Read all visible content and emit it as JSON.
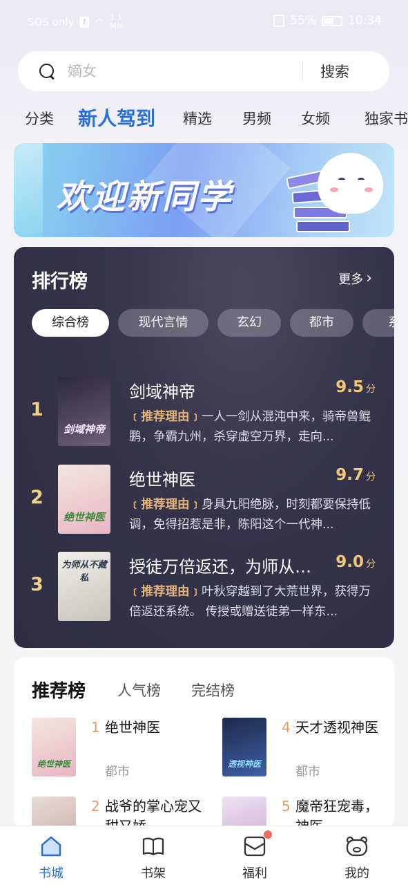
{
  "status_bar": {
    "carrier": "SOS only",
    "speed_value": "1.1",
    "speed_unit": "M/s",
    "battery": "55%",
    "battery_level": 0.55,
    "time": "10:34"
  },
  "search": {
    "placeholder": "嫡女",
    "button": "搜索"
  },
  "tabs": [
    "分类",
    "新人驾到",
    "精选",
    "男频",
    "女频",
    "独家书"
  ],
  "active_tab": "新人驾到",
  "banner": {
    "title": "欢迎新同学"
  },
  "ranking": {
    "title": "排行榜",
    "more": "更多",
    "chips": [
      "综合榜",
      "现代言情",
      "玄幻",
      "都市",
      "系"
    ],
    "active_chip": "综合榜",
    "reason_label": "推荐理由",
    "score_unit": "分",
    "items": [
      {
        "rank": "1",
        "title": "剑域神帝",
        "score": "9.5",
        "reason": "一人一剑从混沌中来，骑帝兽鲲鹏，争霸九州，杀穿虚空万界，走向...",
        "cover_text": "剑域神帝",
        "cover_colors": [
          "#2e2a3a",
          "#6c5f7a"
        ]
      },
      {
        "rank": "2",
        "title": "绝世神医",
        "score": "9.7",
        "reason": "身具九阳绝脉，时刻都要保持低调，免得招惹是非，陈阳这个一代神...",
        "cover_text": "绝世神医",
        "cover_colors": [
          "#f3e6e0",
          "#e9b6c4"
        ]
      },
      {
        "rank": "3",
        "title": "授徒万倍返还，为师从不藏私",
        "score": "9.0",
        "reason": "叶秋穿越到了大荒世界，获得万倍返还系统。 传授或赠送徒弟一样东...",
        "cover_text": "为师从不藏私",
        "cover_colors": [
          "#f1efe9",
          "#c7c4bc"
        ]
      }
    ]
  },
  "recommend": {
    "tabs": [
      "推荐榜",
      "人气榜",
      "完结榜"
    ],
    "active_tab": "推荐榜",
    "items": [
      {
        "rank": "1",
        "title": "绝世神医",
        "category": "都市",
        "cover_text": "绝世神医",
        "cover_colors": [
          "#f3e6e0",
          "#e9b6c4"
        ]
      },
      {
        "rank": "4",
        "title": "天才透视神医",
        "category": "都市",
        "cover_text": "透视神医",
        "cover_colors": [
          "#1d2a4a",
          "#3f5fa6"
        ]
      },
      {
        "rank": "2",
        "title": "战爷的掌心宠又甜又娇",
        "category": "",
        "cover_text": "",
        "cover_colors": [
          "#e8dcd6",
          "#c9a7a0"
        ]
      },
      {
        "rank": "5",
        "title": "魔帝狂宠毒，神医",
        "category": "",
        "cover_text": "",
        "cover_colors": [
          "#efe3f1",
          "#c7a3d3"
        ]
      }
    ]
  },
  "bottom_nav": {
    "items": [
      "书城",
      "书架",
      "福利",
      "我的"
    ],
    "active": "书城"
  },
  "colors": {
    "accent": "#2a6fd6",
    "rank_number": "#f2cf83",
    "score": "#f0c978",
    "reason_tag": "#e4b57b",
    "notify_dot": "#f06a5c"
  }
}
